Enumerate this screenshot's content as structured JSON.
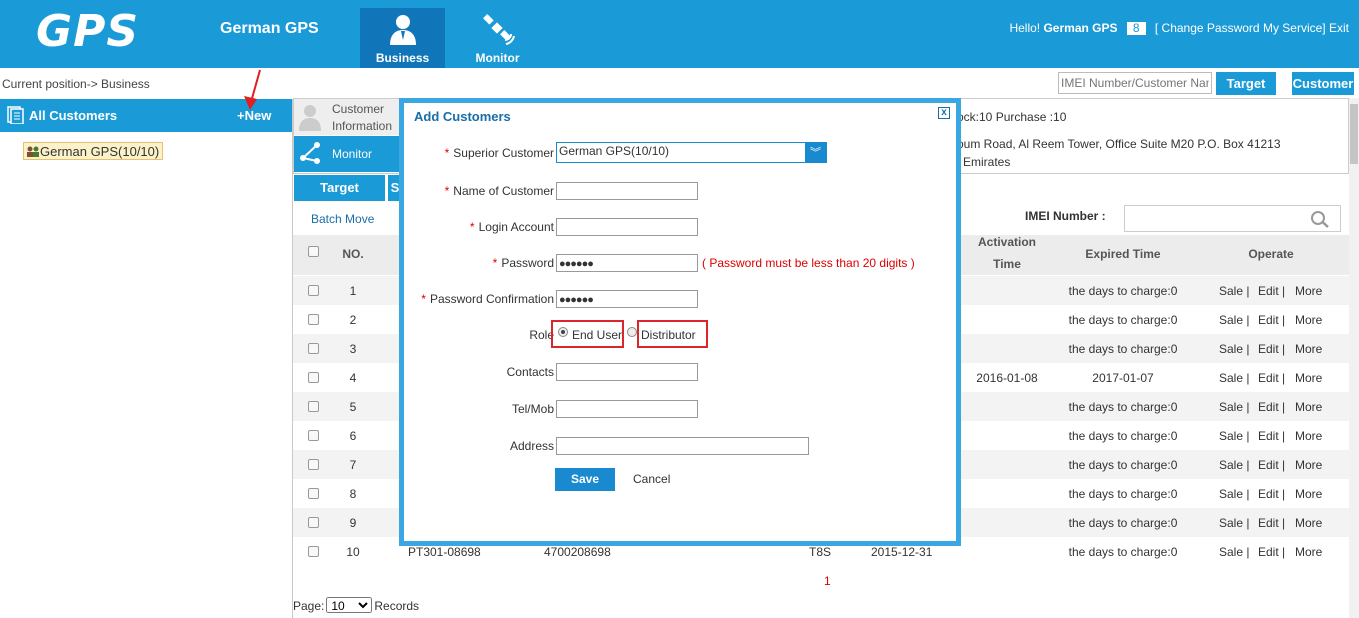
{
  "header": {
    "logo": "GPS",
    "company": "German GPS",
    "nav": [
      {
        "label": "Business",
        "icon": "person-icon"
      },
      {
        "label": "Monitor",
        "icon": "satellite-icon"
      }
    ],
    "hello": "Hello!",
    "username": "German GPS",
    "message_count": "8",
    "change_password": "[ Change Password",
    "my_service": "My Service]",
    "exit": "Exit"
  },
  "breadcrumb": "Current position-> Business",
  "search": {
    "placeholder": "IMEI Number/Customer Nam",
    "target_label": "Target",
    "customer_label": "Customer"
  },
  "left": {
    "title": "All Customers",
    "new_label": "+New",
    "tree_node": "German GPS(10/10)"
  },
  "info": {
    "tab_customer_line1": "Customer",
    "tab_customer_line2": "Information",
    "tab_monitor": "Monitor",
    "stock_text": "ock:10 Purchase :10",
    "address_line1": "oum Road, Al Reem Tower, Office Suite M20 P.O. Box 41213",
    "address_line2": "Emirates"
  },
  "subtabs": {
    "target": "Target",
    "second": "S"
  },
  "batch_move": "Batch Move",
  "imei_label": "IMEI Number :",
  "table": {
    "headers": {
      "no": "NO.",
      "activation_line1": "Activation",
      "activation_line2": "Time",
      "expired": "Expired Time",
      "operate": "Operate"
    },
    "rows": [
      {
        "no": "1",
        "name": "",
        "imei": "",
        "model": "",
        "date": "",
        "activation": "",
        "expired": "the days to charge:0"
      },
      {
        "no": "2",
        "name": "",
        "imei": "",
        "model": "",
        "date": "",
        "activation": "",
        "expired": "the days to charge:0"
      },
      {
        "no": "3",
        "name": "",
        "imei": "",
        "model": "",
        "date": "",
        "activation": "",
        "expired": "the days to charge:0"
      },
      {
        "no": "4",
        "name": "",
        "imei": "",
        "model": "",
        "date": "",
        "activation": "2016-01-08",
        "expired": "2017-01-07"
      },
      {
        "no": "5",
        "name": "",
        "imei": "",
        "model": "",
        "date": "",
        "activation": "",
        "expired": "the days to charge:0"
      },
      {
        "no": "6",
        "name": "",
        "imei": "",
        "model": "",
        "date": "",
        "activation": "",
        "expired": "the days to charge:0"
      },
      {
        "no": "7",
        "name": "",
        "imei": "",
        "model": "",
        "date": "",
        "activation": "",
        "expired": "the days to charge:0"
      },
      {
        "no": "8",
        "name": "",
        "imei": "",
        "model": "",
        "date": "",
        "activation": "",
        "expired": "the days to charge:0"
      },
      {
        "no": "9",
        "name": "",
        "imei": "",
        "model": "",
        "date": "",
        "activation": "",
        "expired": "the days to charge:0"
      },
      {
        "no": "10",
        "name": "PT301-08698",
        "imei": "4700208698",
        "model": "T8S",
        "date": "2015-12-31",
        "activation": "",
        "expired": "the days to charge:0"
      }
    ],
    "ops": {
      "sale": "Sale |",
      "edit": "Edit |",
      "more": "More"
    }
  },
  "pager": {
    "current": "1",
    "page_label": "Page:",
    "page_size": "10",
    "records_label": "Records"
  },
  "modal": {
    "title": "Add Customers",
    "close": "x",
    "superior_label": "Superior Customer",
    "superior_value": "German GPS(10/10)",
    "name_label": "Name of Customer",
    "login_label": "Login Account",
    "password_label": "Password",
    "password_value": "●●●●●●",
    "password_hint": "( Password must be less than 20 digits )",
    "confirm_label": "Password Confirmation",
    "confirm_value": "●●●●●●",
    "role_label": "Role",
    "role_end_user": "End User",
    "role_distributor": "Distributor",
    "contacts_label": "Contacts",
    "tel_label": "Tel/Mob",
    "address_label": "Address",
    "save": "Save",
    "cancel": "Cancel"
  },
  "colors": {
    "primary": "#1a9ad6",
    "dark_blue": "#1176b9",
    "required_red": "#d00000",
    "highlight_red": "#d9252b"
  }
}
